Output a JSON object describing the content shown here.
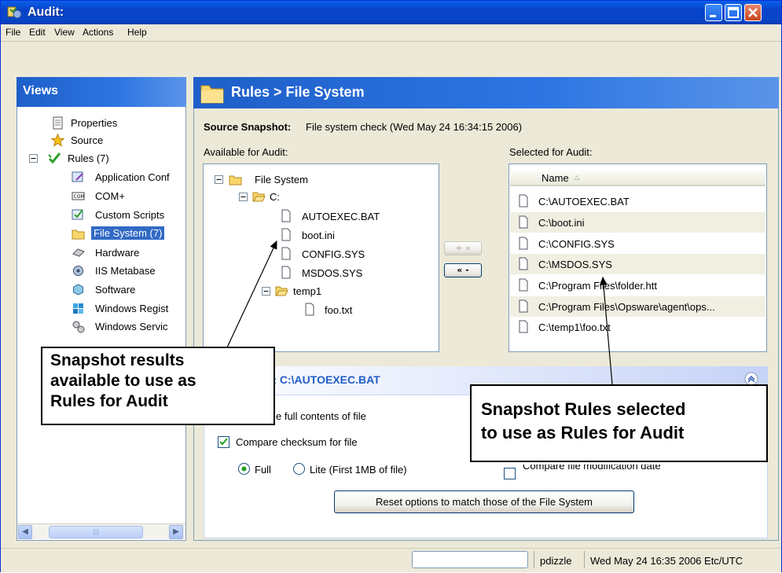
{
  "window": {
    "title": "Audit:"
  },
  "menu": [
    "File",
    "Edit",
    "View",
    "Actions",
    "Help"
  ],
  "views": {
    "header": "Views",
    "items": [
      {
        "label": "Properties",
        "icon": "document-icon"
      },
      {
        "label": "Source",
        "icon": "star-icon"
      },
      {
        "label": "Rules (7)",
        "icon": "rules-check-icon",
        "expanded": true
      },
      {
        "label": "Application Conf",
        "icon": "application-config-icon"
      },
      {
        "label": "COM+",
        "icon": "com-icon"
      },
      {
        "label": "Custom Scripts",
        "icon": "script-icon"
      },
      {
        "label": "File System (7)",
        "icon": "folder-icon",
        "selected": true
      },
      {
        "label": "Hardware",
        "icon": "hardware-icon"
      },
      {
        "label": "IIS Metabase",
        "icon": "iis-icon"
      },
      {
        "label": "Software",
        "icon": "software-icon"
      },
      {
        "label": "Windows Regist",
        "icon": "registry-icon"
      },
      {
        "label": "Windows Servic",
        "icon": "service-icon"
      }
    ]
  },
  "main": {
    "header": "Rules > File System",
    "source_label": "Source Snapshot:",
    "source_value": "File system check  (Wed May 24 16:34:15 2006)",
    "available_label": "Available for Audit:",
    "selected_label": "Selected for Audit:",
    "available_tree": {
      "root": "File System",
      "drive": "C:",
      "files": [
        "AUTOEXEC.BAT",
        "boot.ini",
        "CONFIG.SYS",
        "MSDOS.SYS"
      ],
      "folder": "temp1",
      "folder_files": [
        "foo.txt"
      ]
    },
    "add_button": "+ »",
    "remove_button": "« -",
    "selected_column": "Name",
    "selected_items": [
      "C:\\AUTOEXEC.BAT",
      "C:\\boot.ini",
      "C:\\CONFIG.SYS",
      "C:\\MSDOS.SYS",
      "C:\\Program Files\\folder.htt",
      "C:\\Program Files\\Opsware\\agent\\ops...",
      "C:\\temp1\\foo.txt"
    ],
    "options_title": "ns: C:\\AUTOEXEC.BAT",
    "opt_full_contents": "e full contents of file",
    "opt_checksum": "Compare checksum for file",
    "opt_checksum_checked": true,
    "radio_full": "Full",
    "radio_lite": "Lite (First 1MB of file)",
    "radio_selected": "Full",
    "opt_mod_date": "Compare file modification date",
    "reset_button": "Reset options to match those of the File System"
  },
  "callouts": {
    "left": [
      "Snapshot results",
      "available to use as",
      "Rules for Audit"
    ],
    "right": [
      "Snapshot Rules selected",
      "to use as Rules for Audit"
    ]
  },
  "status": {
    "user": "pdizzle",
    "datetime": "Wed May 24 16:35 2006 Etc/UTC"
  },
  "colors": {
    "title_bar": "#0A5FE8",
    "panel_header": "#1E5FC9",
    "selection": "#316AC5",
    "background": "#ECE9D8"
  }
}
